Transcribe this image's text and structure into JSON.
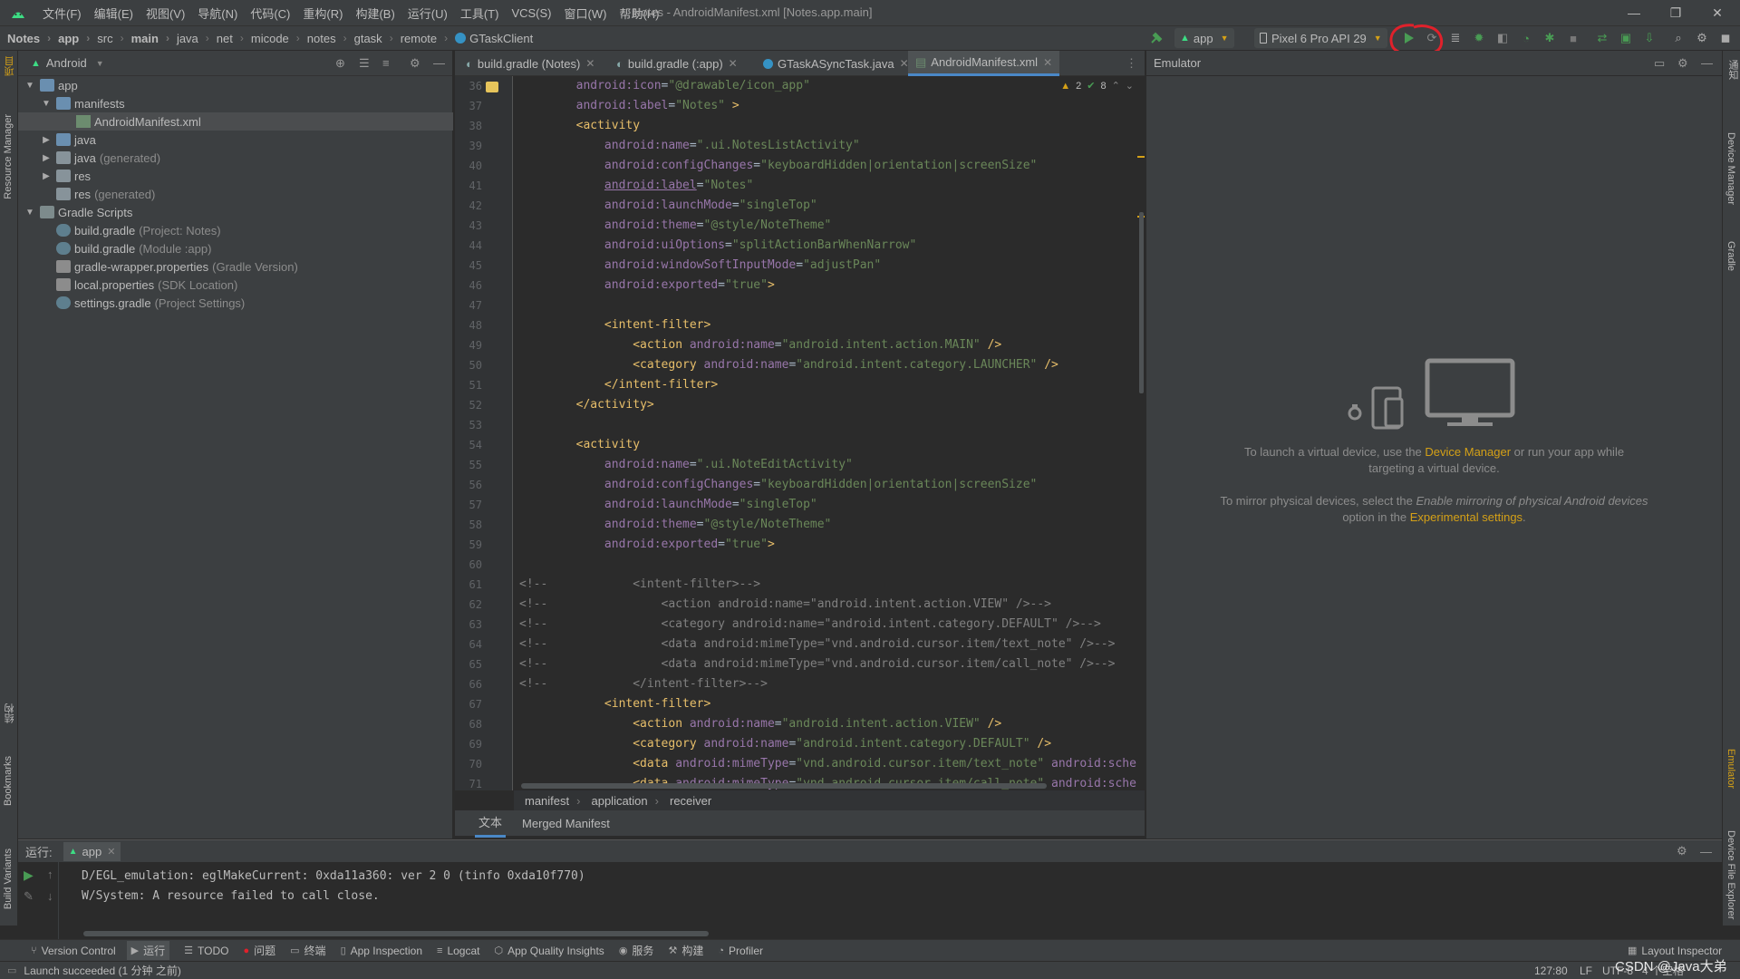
{
  "window": {
    "title": "Notes - AndroidManifest.xml [Notes.app.main]",
    "menu": [
      "文件(F)",
      "编辑(E)",
      "视图(V)",
      "导航(N)",
      "代码(C)",
      "重构(R)",
      "构建(B)",
      "运行(U)",
      "工具(T)",
      "VCS(S)",
      "窗口(W)",
      "帮助(H)"
    ]
  },
  "navbar": {
    "breadcrumbs": [
      "Notes",
      "app",
      "src",
      "main",
      "java",
      "net",
      "micode",
      "notes",
      "gtask",
      "remote",
      "GTaskClient"
    ],
    "run_config": "app",
    "device": "Pixel 6 Pro API 29"
  },
  "project": {
    "view_mode": "Android",
    "tree": [
      {
        "label": "app",
        "sub": ""
      },
      {
        "label": "manifests",
        "sub": ""
      },
      {
        "label": "AndroidManifest.xml",
        "sub": ""
      },
      {
        "label": "java",
        "sub": ""
      },
      {
        "label": "java",
        "sub": "(generated)"
      },
      {
        "label": "res",
        "sub": ""
      },
      {
        "label": "res",
        "sub": "(generated)"
      },
      {
        "label": "Gradle Scripts",
        "sub": ""
      },
      {
        "label": "build.gradle",
        "sub": "(Project: Notes)"
      },
      {
        "label": "build.gradle",
        "sub": "(Module :app)"
      },
      {
        "label": "gradle-wrapper.properties",
        "sub": "(Gradle Version)"
      },
      {
        "label": "local.properties",
        "sub": "(SDK Location)"
      },
      {
        "label": "settings.gradle",
        "sub": "(Project Settings)"
      }
    ]
  },
  "left_stripe": {
    "project": "项目",
    "resource_manager": "Resource Manager",
    "structure": "结构",
    "bookmarks": "Bookmarks",
    "build_variants": "Build Variants"
  },
  "right_stripe": {
    "notifications": "通知",
    "device_manager": "Device Manager",
    "gradle": "Gradle",
    "emulator": "Emulator",
    "device_file_explorer": "Device File Explorer"
  },
  "editor": {
    "tabs": [
      "build.gradle (Notes)",
      "build.gradle (:app)",
      "GTaskASyncTask.java",
      "AndroidManifest.xml"
    ],
    "warnings": "2",
    "weak_warnings": "8",
    "line_numbers": [
      "36",
      "37",
      "38",
      "39",
      "40",
      "41",
      "42",
      "43",
      "44",
      "45",
      "46",
      "47",
      "48",
      "49",
      "50",
      "51",
      "52",
      "53",
      "54",
      "55",
      "56",
      "57",
      "58",
      "59",
      "60",
      "61",
      "62",
      "63",
      "64",
      "65",
      "66",
      "67",
      "68",
      "69",
      "70",
      "71"
    ],
    "breadcrumb": [
      "manifest",
      "application",
      "receiver"
    ],
    "bottom_tabs": [
      "文本",
      "Merged Manifest"
    ]
  },
  "emulator": {
    "title": "Emulator",
    "line1_prefix": "To launch a virtual device, use the ",
    "line1_link": "Device Manager",
    "line1_suffix": " or run your app while",
    "line2": "targeting a virtual device.",
    "line3_prefix": "To mirror physical devices, select the ",
    "line3_italic": "Enable mirroring of physical Android devices",
    "line4_prefix": "option in the ",
    "line4_link": "Experimental settings",
    "line4_suffix": "."
  },
  "run": {
    "label": "运行:",
    "tab": "app",
    "console": [
      "D/EGL_emulation: eglMakeCurrent: 0xda11a360: ver 2 0 (tinfo 0xda10f770)",
      "W/System: A resource failed to call close."
    ]
  },
  "toolwindows": [
    "Version Control",
    "运行",
    "TODO",
    "问题",
    "终端",
    "App Inspection",
    "Logcat",
    "App Quality Insights",
    "服务",
    "构建",
    "Profiler"
  ],
  "layout_inspector": "Layout Inspector",
  "status": {
    "message": "Launch succeeded (1 分钟 之前)",
    "position": "127:80",
    "line_sep": "LF",
    "encoding": "UTF-8",
    "indent": "4 个空格",
    "watermark": "CSDN @Java大弟"
  },
  "colors": {
    "accent_green": "#499c54",
    "highlight_red": "#e0212b",
    "tag": "#e8bf6a",
    "attr": "#9876aa",
    "value": "#6a8759",
    "link": "#d4a017"
  }
}
